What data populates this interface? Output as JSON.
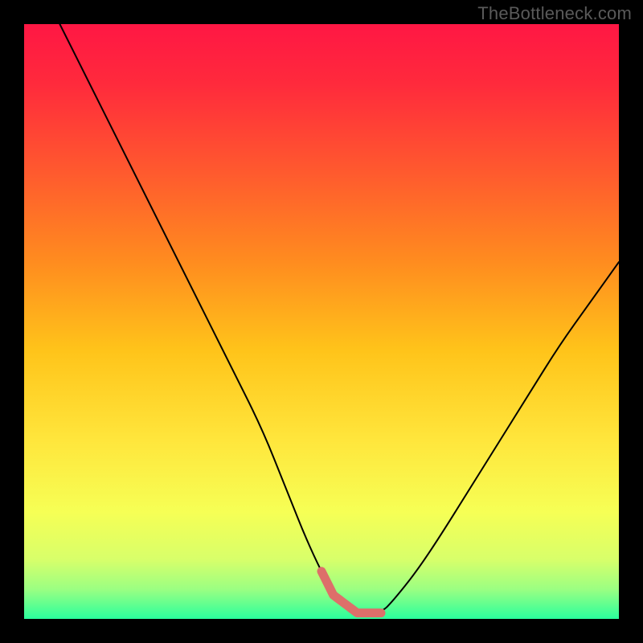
{
  "watermark": "TheBottleneck.com",
  "colors": {
    "frame_bg": "#000000",
    "watermark": "#5a5a5a",
    "curve": "#000000",
    "minimum_highlight": "#dd6f6a",
    "gradient_stops": [
      {
        "offset": 0.0,
        "color": "#ff1744"
      },
      {
        "offset": 0.1,
        "color": "#ff2a3c"
      },
      {
        "offset": 0.25,
        "color": "#ff5a2e"
      },
      {
        "offset": 0.4,
        "color": "#ff8c1f"
      },
      {
        "offset": 0.55,
        "color": "#ffc41a"
      },
      {
        "offset": 0.7,
        "color": "#ffe63c"
      },
      {
        "offset": 0.82,
        "color": "#f6ff55"
      },
      {
        "offset": 0.9,
        "color": "#d8ff6a"
      },
      {
        "offset": 0.95,
        "color": "#9bff82"
      },
      {
        "offset": 1.0,
        "color": "#2aff9d"
      }
    ]
  },
  "chart_data": {
    "type": "line",
    "title": "",
    "xlabel": "",
    "ylabel": "",
    "xlim": [
      0,
      100
    ],
    "ylim": [
      0,
      100
    ],
    "series": [
      {
        "name": "bottleneck-curve",
        "x": [
          6,
          10,
          15,
          20,
          25,
          30,
          35,
          40,
          44,
          48,
          52,
          56,
          60,
          62,
          66,
          70,
          75,
          80,
          85,
          90,
          95,
          100
        ],
        "values": [
          100,
          92,
          82,
          72,
          62,
          52,
          42,
          32,
          22,
          12,
          4,
          1,
          1,
          3,
          8,
          14,
          22,
          30,
          38,
          46,
          53,
          60
        ]
      }
    ],
    "annotations": [
      {
        "name": "optimal-range",
        "x_start": 50,
        "x_end": 60,
        "y": 1,
        "note": "flat minimum region highlighted with coral/salmon stroke"
      }
    ]
  }
}
